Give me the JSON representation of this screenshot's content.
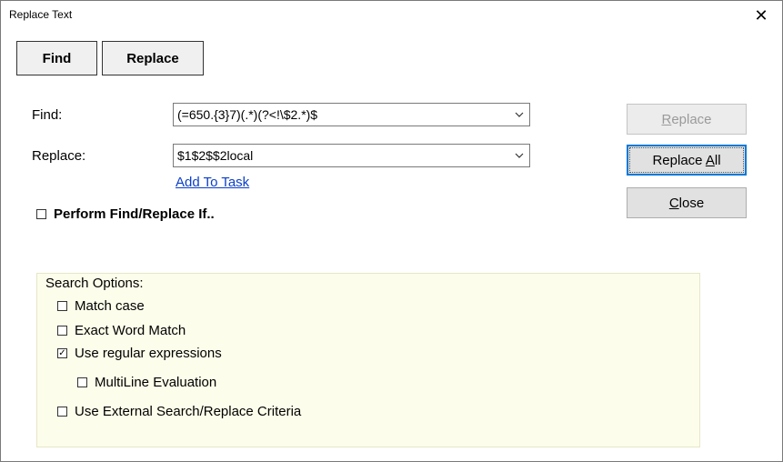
{
  "window": {
    "title": "Replace Text",
    "close_glyph": "✕"
  },
  "tabs": [
    {
      "label": "Find"
    },
    {
      "label": "Replace"
    }
  ],
  "find": {
    "label": "Find:",
    "value": "(=650.{3}7)(.*)(?<!\\$2.*)$"
  },
  "replace": {
    "label": "Replace:",
    "value": "$1$2$$2local"
  },
  "add_to_task": "Add To Task",
  "perform_if": {
    "label": "Perform Find/Replace If..",
    "checked": false
  },
  "buttons": {
    "replace": {
      "pre": "",
      "accel": "R",
      "post": "eplace"
    },
    "replace_all": {
      "pre": "Replace ",
      "accel": "A",
      "post": "ll"
    },
    "close": {
      "pre": "",
      "accel": "C",
      "post": "lose"
    }
  },
  "search_options": {
    "title": "Search Options:",
    "match_case": {
      "label": "Match case",
      "checked": false
    },
    "exact_word": {
      "label": "Exact Word Match",
      "checked": false
    },
    "regex": {
      "label": "Use regular expressions",
      "checked": true
    },
    "multiline": {
      "label": "MultiLine Evaluation",
      "checked": false
    },
    "external": {
      "label": "Use External Search/Replace Criteria",
      "checked": false
    }
  },
  "check_glyph": "✓"
}
